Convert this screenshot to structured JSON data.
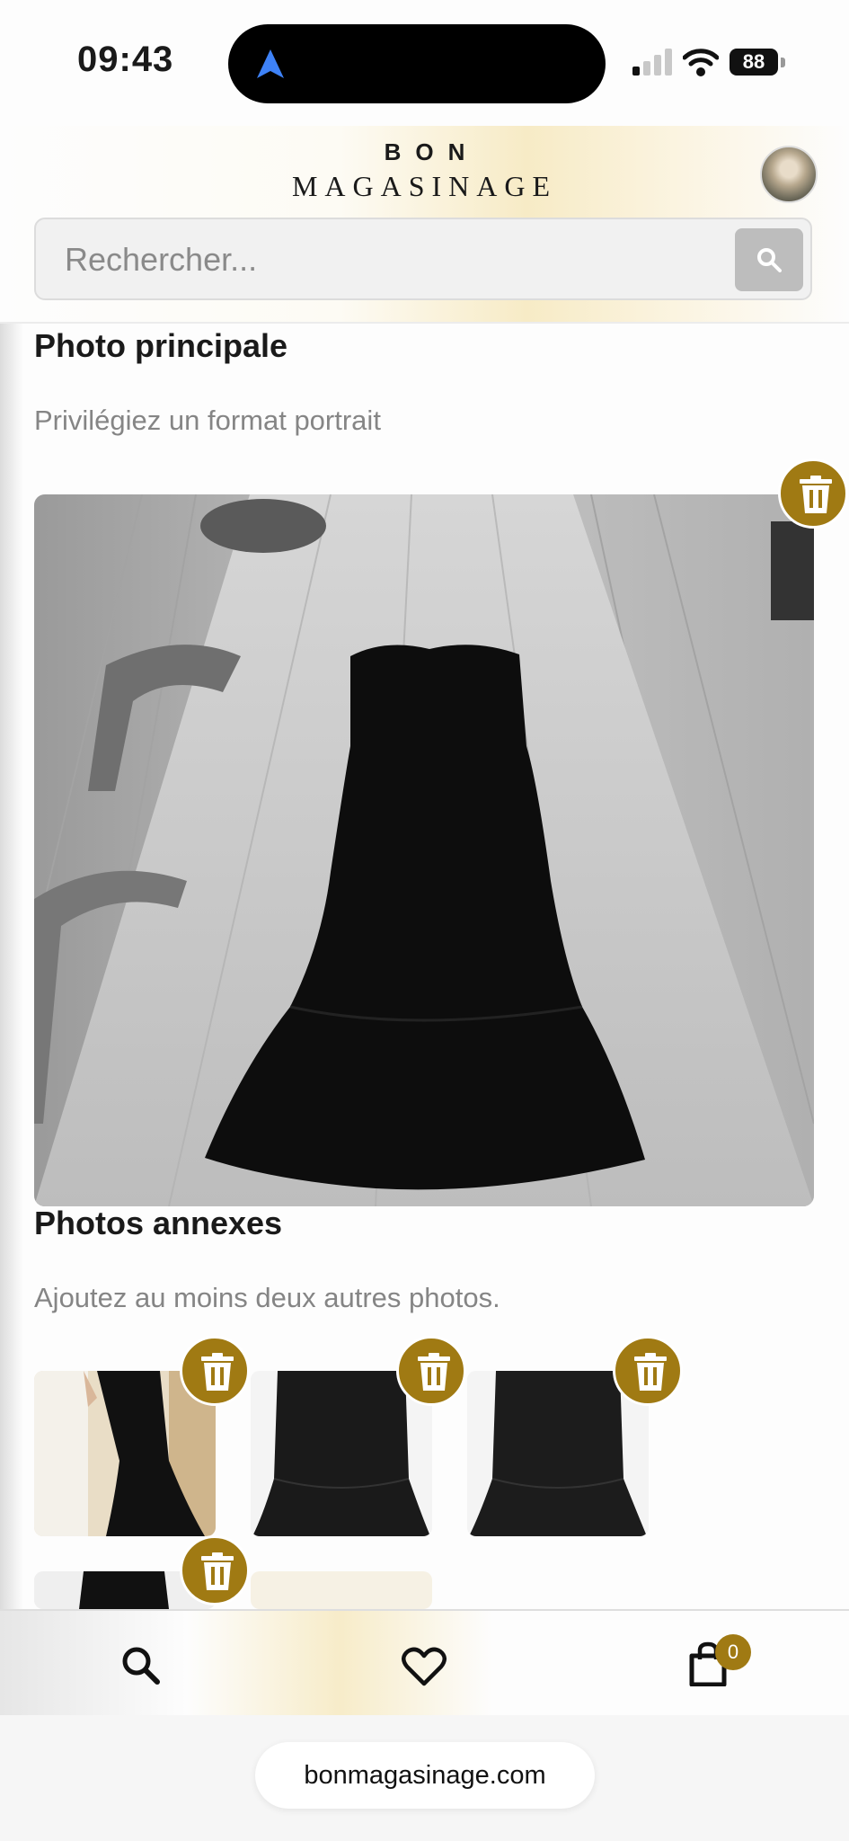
{
  "status_bar": {
    "time": "09:43",
    "battery": "88"
  },
  "header": {
    "logo_top": "BON",
    "logo_bottom": "MAGASINAGE",
    "search_placeholder": "Rechercher..."
  },
  "main_photo": {
    "title": "Photo principale",
    "hint": "Privilégiez un format portrait"
  },
  "extra_photos": {
    "title": "Photos annexes",
    "hint": "Ajoutez au moins deux autres photos."
  },
  "bottom_nav": {
    "cart_count": "0"
  },
  "url_bar": {
    "url": "bonmagasinage.com"
  },
  "colors": {
    "accent": "#a07a13",
    "search_button": "#bdbdbd"
  }
}
